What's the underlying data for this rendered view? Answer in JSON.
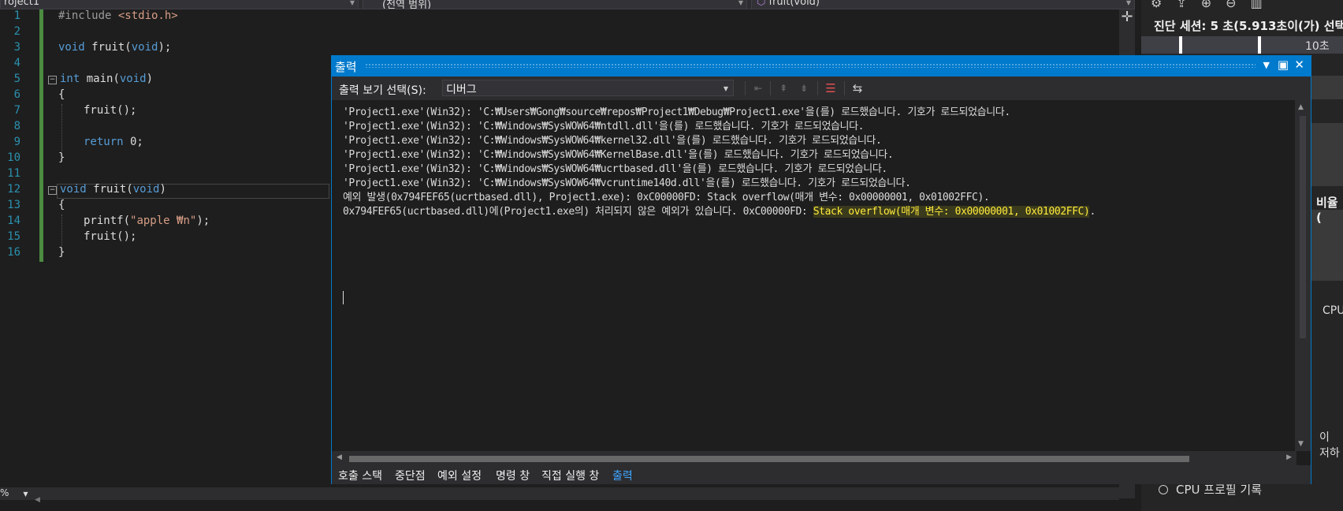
{
  "top_dropdowns": {
    "project": "roject1",
    "scope": "(전역 범위)",
    "function": "fruit(void)"
  },
  "editor": {
    "line_numbers": [
      "1",
      "2",
      "3",
      "4",
      "5",
      "6",
      "7",
      "8",
      "9",
      "10",
      "11",
      "12",
      "13",
      "14",
      "15",
      "16"
    ],
    "zoom": "%"
  },
  "code": {
    "l1_pp": "#include ",
    "l1_hdr": "<stdio.h>",
    "l3_kw": "void",
    "l3_rest": " fruit(",
    "l3_kw2": "void",
    "l3_end": ");",
    "l5_kw": "int",
    "l5_rest": " main(",
    "l5_kw2": "void",
    "l5_end": ")",
    "l6": "{",
    "l7": "fruit();",
    "l9_kw": "return",
    "l9_rest": " 0;",
    "l10": "}",
    "l12_kw": "void",
    "l12_rest": " fruit(",
    "l12_kw2": "void",
    "l12_end": ")",
    "l13": "{",
    "l14_a": "printf(",
    "l14_str": "\"apple ₩n\"",
    "l14_b": ");",
    "l15": "fruit();",
    "l16": "}"
  },
  "output_window": {
    "title": "출력",
    "show_output_from_label": "출력 보기 선택(S):",
    "source": "디버그",
    "lines": [
      "'Project1.exe'(Win32): 'C:₩Users₩Gong₩source₩repos₩Project1₩Debug₩Project1.exe'을(를) 로드했습니다. 기호가 로드되었습니다.",
      "'Project1.exe'(Win32): 'C:₩Windows₩SysWOW64₩ntdll.dll'을(를) 로드했습니다. 기호가 로드되었습니다.",
      "'Project1.exe'(Win32): 'C:₩Windows₩SysWOW64₩kernel32.dll'을(를) 로드했습니다. 기호가 로드되었습니다.",
      "'Project1.exe'(Win32): 'C:₩Windows₩SysWOW64₩KernelBase.dll'을(를) 로드했습니다. 기호가 로드되었습니다.",
      "'Project1.exe'(Win32): 'C:₩Windows₩SysWOW64₩ucrtbased.dll'을(를) 로드했습니다. 기호가 로드되었습니다.",
      "'Project1.exe'(Win32): 'C:₩Windows₩SysWOW64₩vcruntime140d.dll'을(를) 로드했습니다. 기호가 로드되었습니다.",
      "예외 발생(0x794FEF65(ucrtbased.dll), Project1.exe): 0xC00000FD: Stack overflow(매개 변수: 0x00000001, 0x01002FFC)."
    ],
    "last_line_prefix": "0x794FEF65(ucrtbased.dll)에(Project1.exe의) 처리되지 않은 예외가 있습니다. 0xC00000FD: ",
    "last_line_highlight": "Stack overflow(매개 변수: 0x00000001, 0x01002FFC)",
    "last_line_suffix": ".",
    "tabs": [
      "호출 스택",
      "중단점",
      "예외 설정",
      "명령 창",
      "직접 실행 창",
      "출력"
    ],
    "active_tab": "출력"
  },
  "diagnostics": {
    "session": "진단 세션: 5 초(5.913초이(가) 선택",
    "timeline_label": "10초",
    "ratio_label": "비율(",
    "cpu_label": "CPU",
    "low_label": "이 저하",
    "cpu_profiling": "CPU 프로필 기록"
  },
  "icons": {
    "split": "split-plus-icon",
    "pin": "pin-icon",
    "maximize": "maximize-icon",
    "close": "close-icon"
  },
  "colors": {
    "accent": "#007acc",
    "keyword": "#569cd6",
    "string": "#d69d85",
    "line_number": "#2b91af",
    "highlight": "#ffeb3b"
  }
}
